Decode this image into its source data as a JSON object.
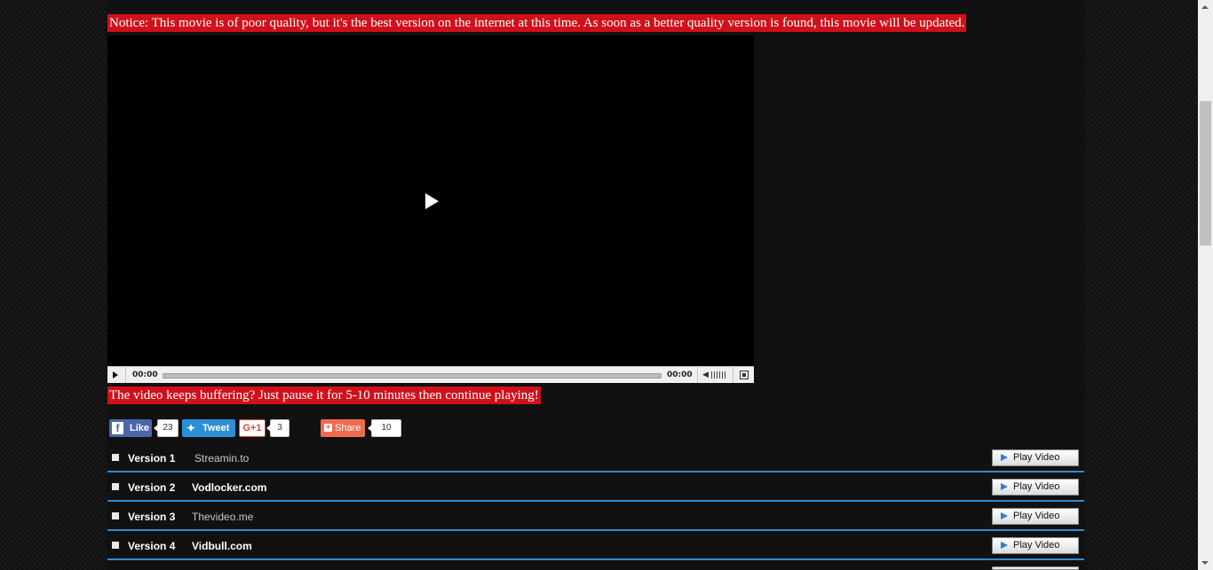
{
  "notices": {
    "quality": "Notice: This movie is of poor quality, but it's the best version on the internet at this time. As soon as a better quality version is found, this movie will be updated.",
    "buffering": "The video keeps buffering? Just pause it for 5-10 minutes then continue playing!"
  },
  "player": {
    "current_time": "00:00",
    "duration": "00:00"
  },
  "social": {
    "facebook": {
      "label": "Like",
      "count": "23"
    },
    "twitter": {
      "label": "Tweet"
    },
    "googleplus": {
      "label": "G+1",
      "count": "3"
    },
    "share": {
      "label": "Share",
      "count": "10"
    }
  },
  "versions": [
    {
      "label": "Version 1",
      "host": "Streamin.to",
      "button": "Play Video"
    },
    {
      "label": "Version 2",
      "host": "Vodlocker.com",
      "button": "Play Video"
    },
    {
      "label": "Version 3",
      "host": "Thevideo.me",
      "button": "Play Video"
    },
    {
      "label": "Version 4",
      "host": "Vidbull.com",
      "button": "Play Video"
    }
  ],
  "colors": {
    "notice_bg": "#d0101a",
    "row_divider": "#2d8ad6"
  }
}
